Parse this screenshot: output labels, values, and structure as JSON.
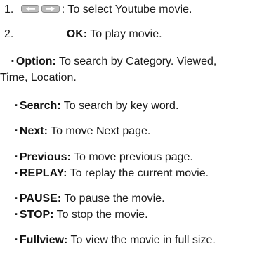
{
  "items": [
    {
      "prefix": "1.",
      "key": "",
      "desc": ": To select Youtube movie."
    },
    {
      "prefix": "2.",
      "key": "OK:",
      "desc": " To play movie."
    },
    {
      "prefix": "",
      "key": "Option:",
      "desc": " To search by Category. Viewed,"
    },
    {
      "prefix": "",
      "key": "",
      "desc": "Time, Location."
    },
    {
      "prefix": "",
      "key": "Search:",
      "desc": " To search by key word."
    },
    {
      "prefix": "",
      "key": "Next:",
      "desc": " To move Next page."
    },
    {
      "prefix": "",
      "key": "Previous:",
      "desc": " To move previous page."
    },
    {
      "prefix": "",
      "key": "REPLAY:",
      "desc": " To replay the current movie."
    },
    {
      "prefix": "",
      "key": "PAUSE:",
      "desc": " To pause the movie."
    },
    {
      "prefix": "",
      "key": "STOP:",
      "desc": " To stop the movie."
    },
    {
      "prefix": "",
      "key": "Fullview:",
      "desc": " To view the movie in full size."
    }
  ],
  "icons": {
    "left_arrow": "left-arrow-key-icon",
    "right_arrow": "right-arrow-key-icon"
  },
  "bullet_char": "▪"
}
